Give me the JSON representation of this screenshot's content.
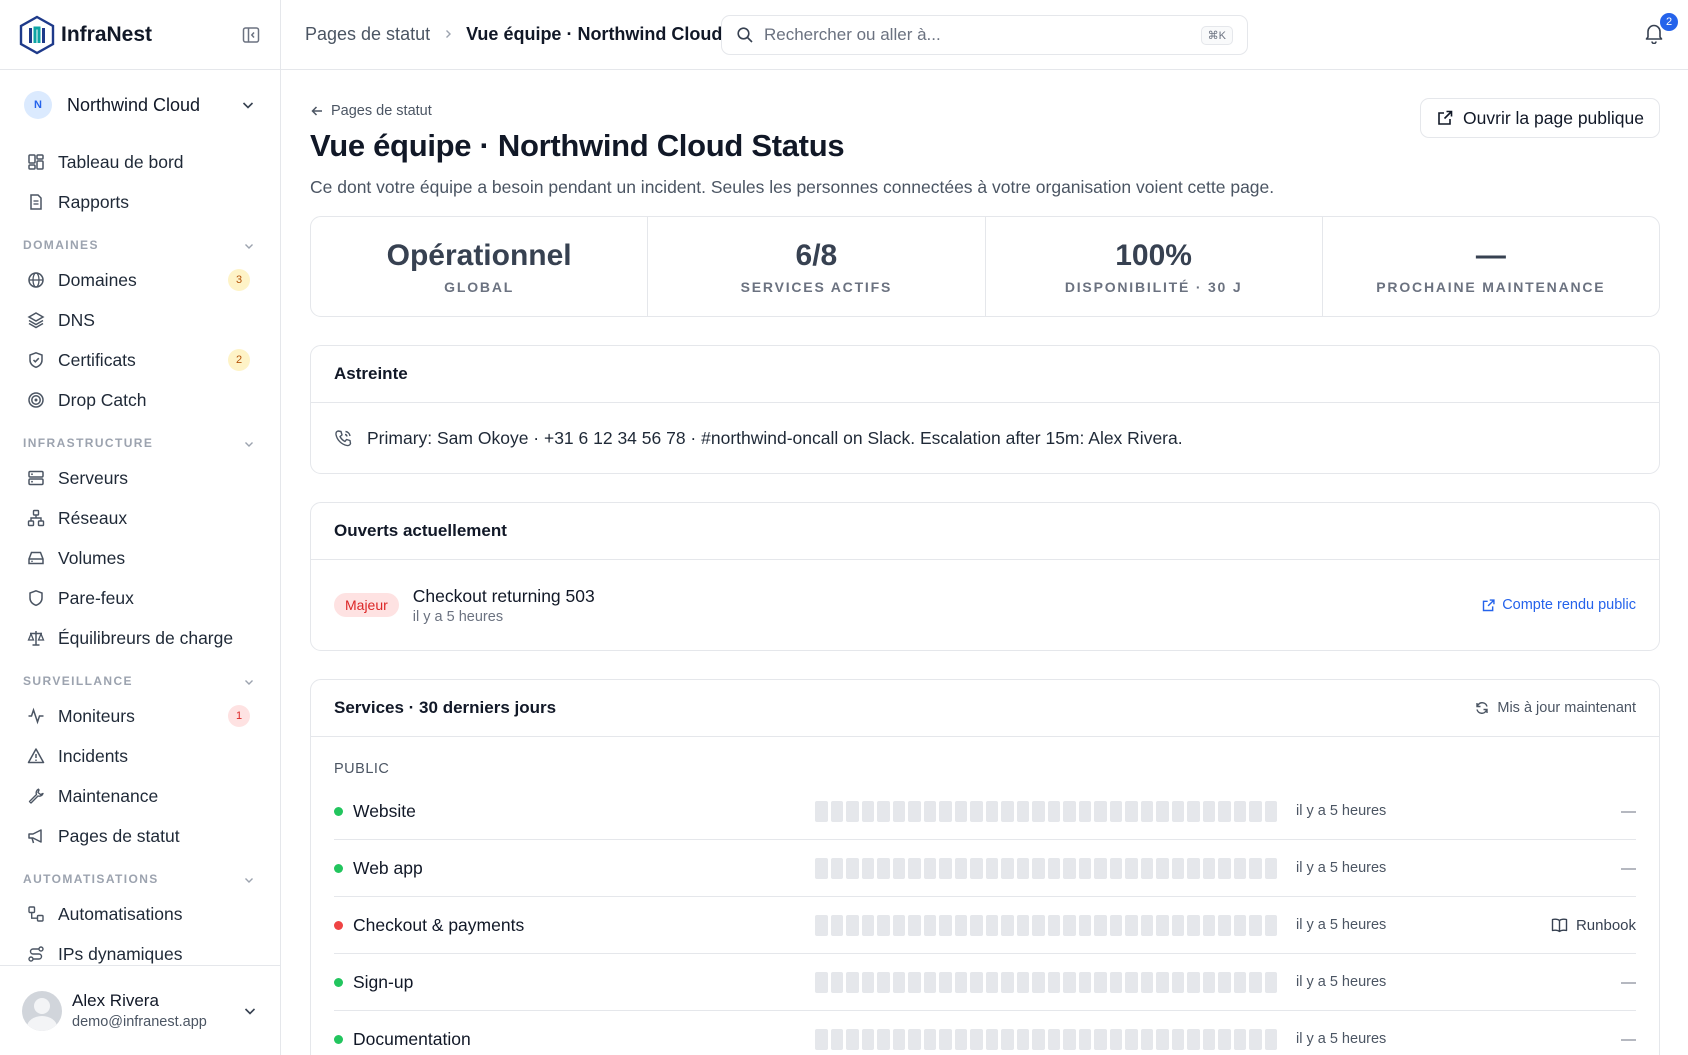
{
  "brand": {
    "name": "InfraNest"
  },
  "org": {
    "initial": "N",
    "name": "Northwind Cloud"
  },
  "nav": {
    "top": [
      {
        "label": "Tableau de bord",
        "icon": "dashboard-icon"
      },
      {
        "label": "Rapports",
        "icon": "document-icon"
      }
    ],
    "sections": [
      {
        "title": "DOMAINES",
        "items": [
          {
            "label": "Domaines",
            "icon": "globe-icon",
            "badge": "3",
            "badge_color": "amber"
          },
          {
            "label": "DNS",
            "icon": "layers-icon"
          },
          {
            "label": "Certificats",
            "icon": "shield-check-icon",
            "badge": "2",
            "badge_color": "amber"
          },
          {
            "label": "Drop Catch",
            "icon": "target-icon"
          }
        ]
      },
      {
        "title": "INFRASTRUCTURE",
        "items": [
          {
            "label": "Serveurs",
            "icon": "server-icon"
          },
          {
            "label": "Réseaux",
            "icon": "network-icon"
          },
          {
            "label": "Volumes",
            "icon": "hard-drive-icon"
          },
          {
            "label": "Pare-feux",
            "icon": "shield-icon"
          },
          {
            "label": "Équilibreurs de charge",
            "icon": "scale-icon"
          }
        ]
      },
      {
        "title": "SURVEILLANCE",
        "items": [
          {
            "label": "Moniteurs",
            "icon": "activity-icon",
            "badge": "1",
            "badge_color": "red"
          },
          {
            "label": "Incidents",
            "icon": "alert-triangle-icon"
          },
          {
            "label": "Maintenance",
            "icon": "wrench-icon"
          },
          {
            "label": "Pages de statut",
            "icon": "megaphone-icon"
          }
        ]
      },
      {
        "title": "AUTOMATISATIONS",
        "items": [
          {
            "label": "Automatisations",
            "icon": "workflow-icon"
          },
          {
            "label": "IPs dynamiques",
            "icon": "route-icon"
          }
        ]
      }
    ]
  },
  "user": {
    "name": "Alex Rivera",
    "email": "demo@infranest.app"
  },
  "topbar": {
    "crumb_parent": "Pages de statut",
    "crumb_current": "Vue équipe · Northwind Cloud Status",
    "search_placeholder": "Rechercher ou aller à...",
    "search_shortcut": "⌘K",
    "notifications": "2"
  },
  "page": {
    "back_label": "Pages de statut",
    "open_public_label": "Ouvrir la page publique",
    "title": "Vue équipe · Northwind Cloud Status",
    "subtitle": "Ce dont votre équipe a besoin pendant un incident. Seules les personnes connectées à votre organisation voient cette page."
  },
  "stats": [
    {
      "value": "Opérationnel",
      "label": "GLOBAL"
    },
    {
      "value": "6/8",
      "label": "SERVICES ACTIFS"
    },
    {
      "value": "100%",
      "label": "DISPONIBILITÉ · 30 J"
    },
    {
      "value": "—",
      "label": "PROCHAINE MAINTENANCE"
    }
  ],
  "oncall": {
    "title": "Astreinte",
    "text": "Primary: Sam Okoye · +31 6 12 34 56 78 · #northwind-oncall on Slack. Escalation after 15m: Alex Rivera."
  },
  "open_incidents": {
    "title": "Ouverts actuellement",
    "items": [
      {
        "severity": "Majeur",
        "title": "Checkout returning 503",
        "time": "il y a 5 heures",
        "link_label": "Compte rendu public"
      }
    ]
  },
  "services": {
    "title": "Services · 30 derniers jours",
    "refresh_label": "Mis à jour maintenant",
    "group": "PUBLIC",
    "colors": {
      "ok": "#22c55e",
      "down": "#ef4444"
    },
    "items": [
      {
        "name": "Website",
        "status": "ok",
        "time": "il y a 5 heures",
        "action": "—"
      },
      {
        "name": "Web app",
        "status": "ok",
        "time": "il y a 5 heures",
        "action": "—"
      },
      {
        "name": "Checkout & payments",
        "status": "down",
        "time": "il y a 5 heures",
        "action": "Runbook"
      },
      {
        "name": "Sign-up",
        "status": "ok",
        "time": "il y a 5 heures",
        "action": "—"
      },
      {
        "name": "Documentation",
        "status": "ok",
        "time": "il y a 5 heures",
        "action": "—"
      }
    ]
  }
}
